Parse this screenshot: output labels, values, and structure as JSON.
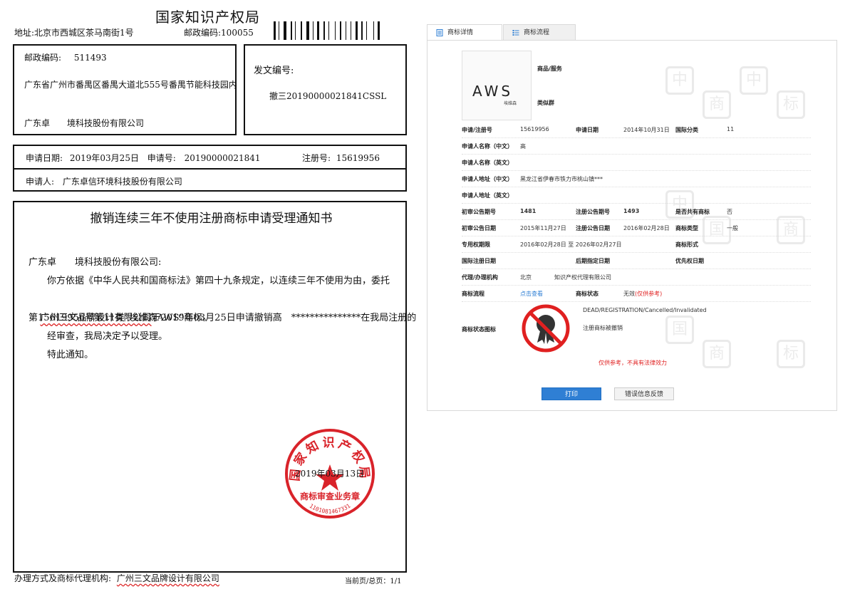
{
  "notice": {
    "office_title": "国家知识产权局",
    "address": "地址:北京市西城区茶马南街1号",
    "office_zip": "邮政编码:100055",
    "recipient": {
      "zip_label": "邮政编码:",
      "zip": "511493",
      "address": "广东省广州市番禺区番禺大道北555号番禺节能科技园内",
      "company": "广东卓　　境科技股份有限公司"
    },
    "reference": {
      "label": "发文编号:",
      "number": "撤三20190000021841CSSL"
    },
    "application": {
      "date_label": "申请日期:",
      "date": "2019年03月25日",
      "app_no_label": "申请号:",
      "app_no": "20190000021841",
      "reg_no_label": "注册号:",
      "reg_no": "15619956",
      "applicant_label": "申请人:",
      "applicant": "广东卓信环境科技股份有限公司"
    },
    "heading": "撤销连续三年不使用注册商标申请受理通知书",
    "salutation": "广东卓　　境科技股份有限公司:",
    "body_line1": "你方依据《中华人民共和国商标法》第四十九条规定，以连续三年不使用为由，委托",
    "body_line2a": "广州三文品牌设计有限公司",
    "body_line2b": "于2019年03月25日申请撤销高　***************在我局注册的",
    "body_line3": "第15619956号第11类“埃维森AWS”商标。",
    "body_line4": "经审查，我局决定予以受理。",
    "body_line5": "特此通知。",
    "issue_date": "2019年03月13日",
    "seal": {
      "top_text": "国家知识产权局",
      "bottom_text": "商标审查业务章",
      "serial": "1101081467331"
    },
    "footer_agent_label": "办理方式及商标代理机构:",
    "footer_agent": "广州三文品牌设计有限公司",
    "footer_page": "当前页/总页：1/1"
  },
  "panel": {
    "tabs": [
      {
        "label": "商标详情",
        "icon": "document-icon"
      },
      {
        "label": "商标流程",
        "icon": "list-icon"
      }
    ],
    "logo_text": "AWS",
    "logo_sub": "埃维森",
    "goods_label": "商品/服务",
    "similar_label": "类似群",
    "fields": {
      "reg_no_label": "申请/注册号",
      "reg_no": "15619956",
      "app_date_label": "申请日期",
      "app_date": "2014年10月31日",
      "intl_class_label": "国际分类",
      "intl_class": "11",
      "name_cn_label": "申请人名称（中文）",
      "name_cn": "高",
      "name_en_label": "申请人名称（英文）",
      "addr_cn_label": "申请人地址（中文）",
      "addr_cn": "黑龙江省伊春市铁力市桃山镇***",
      "addr_en_label": "申请人地址（英文）",
      "prelim_no_label": "初审公告期号",
      "prelim_no": "1481",
      "reg_pub_no_label": "注册公告期号",
      "reg_pub_no": "1493",
      "shared_label": "是否共有商标",
      "shared": "否",
      "prelim_date_label": "初审公告日期",
      "prelim_date": "2015年11月27日",
      "reg_pub_date_label": "注册公告日期",
      "reg_pub_date": "2016年02月28日",
      "tm_type_label": "商标类型",
      "tm_type": "一般",
      "exclusive_label": "专用权期限",
      "exclusive": "2016年02月28日 至 2026年02月27日",
      "tm_form_label": "商标形式",
      "intl_reg_date_label": "国际注册日期",
      "later_date_label": "后期指定日期",
      "priority_date_label": "优先权日期",
      "agent_label": "代理/办理机构",
      "agent_city": "北京",
      "agent": "知识产权代理有限公司",
      "flow_label": "商标流程",
      "flow_link": "点击查看",
      "status_label": "商标状态",
      "status": "无效",
      "status_note": "(仅供参考)",
      "status_icon_label": "商标状态图标",
      "status_en": "DEAD/REGISTRATION/Cancelled/Invalidated",
      "status_cn": "注册商标被撤销"
    },
    "disclaimer": "仅供参考，不具有法律效力",
    "print_button": "打印",
    "feedback_button": "错误信息反馈",
    "watermark_chars": [
      "中",
      "国",
      "商",
      "标"
    ],
    "colors": {
      "accent": "#2f7fd4",
      "warning": "#e02020",
      "seal": "#d9232a"
    }
  }
}
